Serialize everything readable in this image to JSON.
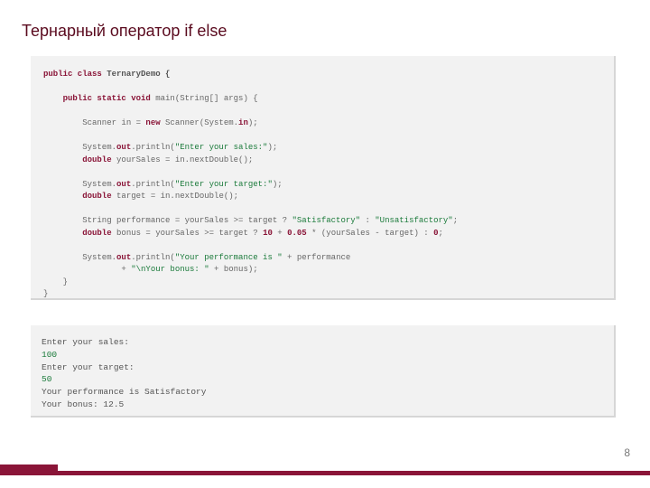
{
  "title": "Тернарный оператор if else",
  "code": {
    "t01a": "public class",
    "t01b": " TernaryDemo {",
    "t02a": "    public static void",
    "t02b": " main(String[] args) {",
    "t03a": "        Scanner in = ",
    "t03b": "new",
    "t03c": " Scanner(System.",
    "t03d": "in",
    "t03e": ");",
    "t04a": "        System.",
    "t04b": "out",
    "t04c": ".println(",
    "t04d": "\"Enter your sales:\"",
    "t04e": ");",
    "t05a": "        double",
    "t05b": " yourSales = in.nextDouble();",
    "t06a": "        System.",
    "t06b": "out",
    "t06c": ".println(",
    "t06d": "\"Enter your target:\"",
    "t06e": ");",
    "t07a": "        double",
    "t07b": " target = in.nextDouble();",
    "t08a": "        String performance = yourSales >= target ? ",
    "t08b": "\"Satisfactory\"",
    "t08c": " : ",
    "t08d": "\"Unsatisfactory\"",
    "t08e": ";",
    "t09a": "        double",
    "t09b": " bonus = yourSales >= target ? ",
    "t09c": "10",
    "t09d": " + ",
    "t09e": "0.05",
    "t09f": " * (yourSales - target) : ",
    "t09g": "0",
    "t09h": ";",
    "t10a": "        System.",
    "t10b": "out",
    "t10c": ".println(",
    "t10d": "\"Your performance is \"",
    "t10e": " + performance",
    "t11a": "                + ",
    "t11b": "\"\\nYour bonus: \"",
    "t11c": " + bonus);",
    "t12": "    }",
    "t13": "}"
  },
  "output": {
    "l1": "Enter your sales:",
    "l2": "100",
    "l3": "Enter your target:",
    "l4": "50",
    "l5": "Your performance is Satisfactory",
    "l6": "Your bonus: 12.5"
  },
  "page_number": "8"
}
